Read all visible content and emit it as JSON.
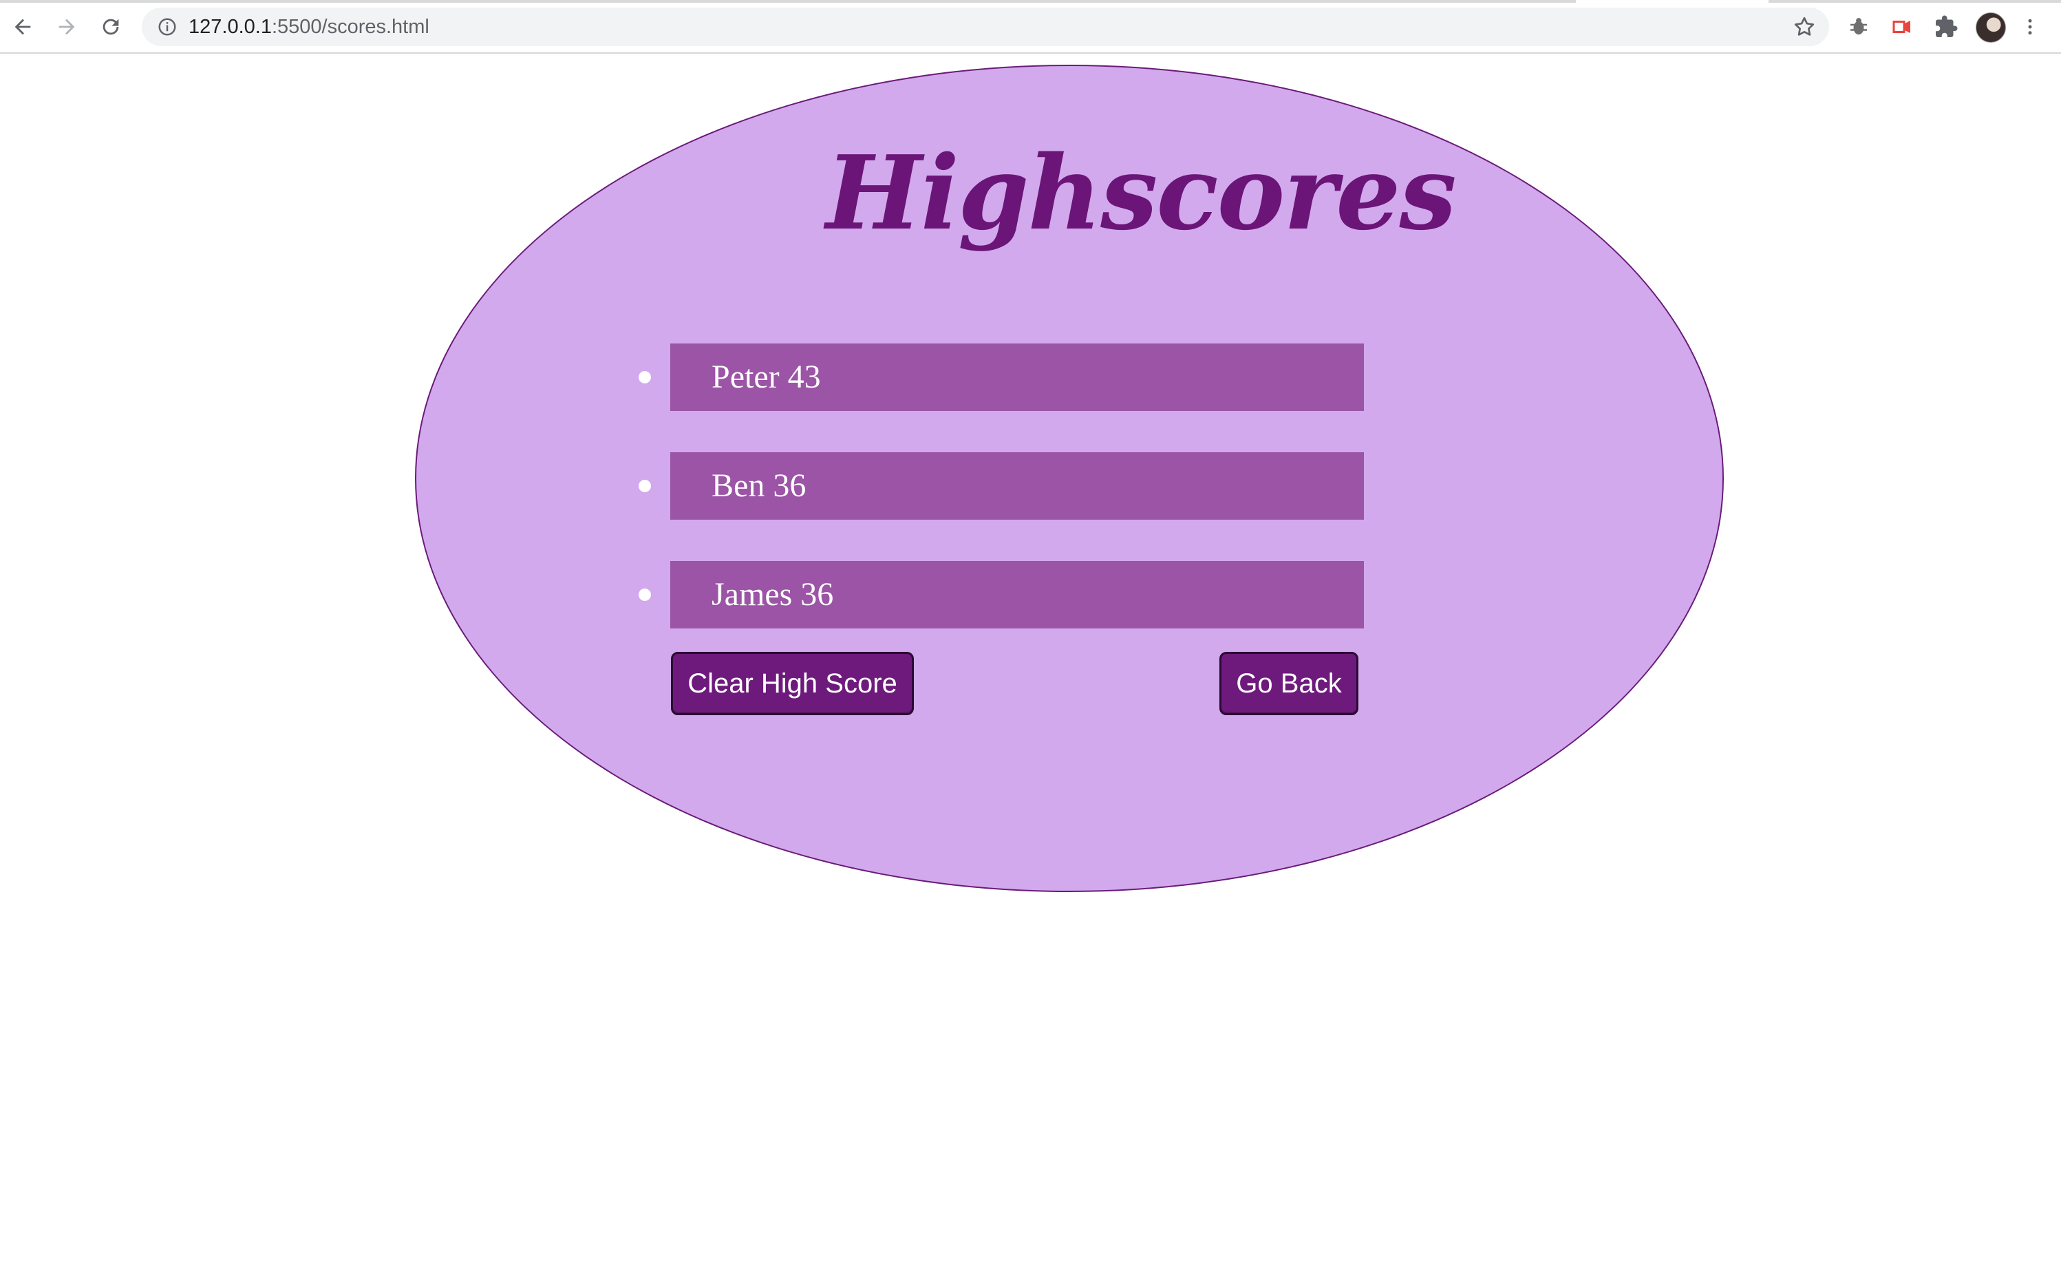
{
  "browser": {
    "url_host": "127.0.0.1",
    "url_rest": ":5500/scores.html"
  },
  "page": {
    "title": "Highscores",
    "scores": [
      {
        "label": "Peter 43"
      },
      {
        "label": "Ben 36"
      },
      {
        "label": "James 36"
      }
    ],
    "buttons": {
      "clear_label": "Clear High Score",
      "back_label": "Go Back"
    }
  },
  "colors": {
    "panel_background": "#d2a9ec",
    "panel_border": "#6a1b7a",
    "score_row": "#9b54a6",
    "button": "#6e1a7c",
    "title": "#6b1578"
  },
  "icons": [
    "back-arrow-icon",
    "forward-arrow-icon",
    "reload-icon",
    "info-icon",
    "star-icon",
    "bug-extension-icon",
    "media-extension-icon",
    "puzzle-extensions-icon",
    "kebab-menu-icon"
  ]
}
